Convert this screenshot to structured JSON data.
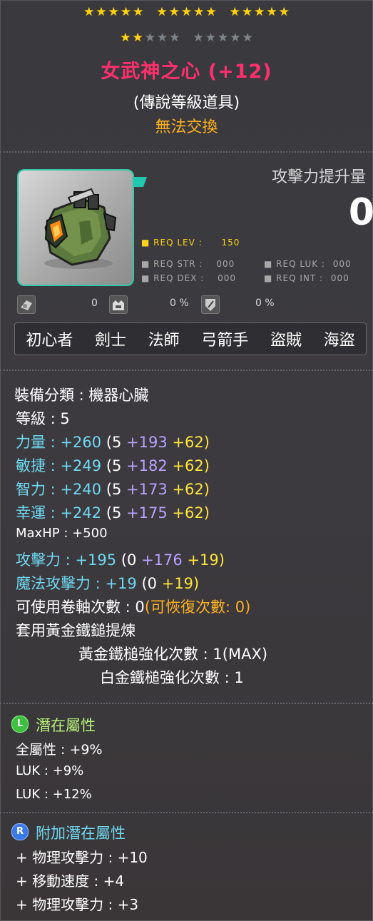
{
  "stars": {
    "row1_groups": [
      5,
      5,
      5
    ],
    "row2_gold": 2,
    "row2_groups": [
      5,
      5
    ]
  },
  "item": {
    "title": "女武神之心 (+12)",
    "rank": "(傳說等級道具)",
    "trade": "無法交換",
    "atk_label": "攻擊力提升量",
    "atk_value": "0",
    "image_icon": "machine-heart-icon"
  },
  "requirements": {
    "lev_label": "REQ LEV :",
    "lev_value": "150",
    "str_label": "REQ STR :",
    "str_value": "000",
    "luk_label": "REQ LUK :",
    "luk_value": "000",
    "dex_label": "REQ DEX :",
    "dex_value": "000",
    "int_label": "REQ INT :",
    "int_value": "000"
  },
  "icons_row": {
    "v1": "0",
    "v2": "0 %",
    "v3": "0 %"
  },
  "jobs": [
    "初心者",
    "劍士",
    "法師",
    "弓箭手",
    "盜賊",
    "海盜"
  ],
  "stats": {
    "category": "裝備分類 : 機器心臟",
    "level": "等級 : 5",
    "str_label": "力量 :",
    "str_total": "+260",
    "str_base": "(5",
    "str_star": "+193",
    "str_flame": "+62)",
    "dex_label": "敏捷 :",
    "dex_total": "+249",
    "dex_base": "(5",
    "dex_star": "+182",
    "dex_flame": "+62)",
    "int_label": "智力 :",
    "int_total": "+240",
    "int_base": "(5",
    "int_star": "+173",
    "int_flame": "+62)",
    "luk_label": "幸運 :",
    "luk_total": "+242",
    "luk_base": "(5",
    "luk_star": "+175",
    "luk_flame": "+62)",
    "maxhp": "MaxHP : +500",
    "atk_label": "攻擊力 :",
    "atk_total": "+195",
    "atk_base": "(0",
    "atk_star": "+176",
    "atk_flame": "+19)",
    "matk_label": "魔法攻擊力 :",
    "matk_total": "+19",
    "matk_base": "(0",
    "matk_flame": "+19)",
    "scroll": "可使用卷軸次數 : 0",
    "scroll_restore": "(可恢復次數: 0)",
    "golden_applied": "套用黃金鐵鎚提煉",
    "golden_count": "黃金鐵槌強化次數 : 1(MAX)",
    "platinum_count": "白金鐵槌強化次數 : 1"
  },
  "potential": {
    "badge": "L",
    "title": "潛在屬性",
    "lines": [
      "全屬性 : +9%",
      "LUK : +9%",
      "LUK : +12%"
    ]
  },
  "additional": {
    "badge": "R",
    "title": "附加潛在屬性",
    "lines": [
      "+ 物理攻擊力 : +10",
      "+ 移動速度 : +4",
      "+ 物理攻擊力 : +3"
    ]
  },
  "colors": {
    "title": "#ff2f6e",
    "trade": "#ffb21e",
    "frame": "#2fc8a8",
    "stat_label": "#6fd8f0",
    "star_force": "#b9a3ff",
    "flame": "#ffe43a",
    "legendary_badge": "#3fbf3f",
    "rare_badge": "#3a7ae8"
  }
}
